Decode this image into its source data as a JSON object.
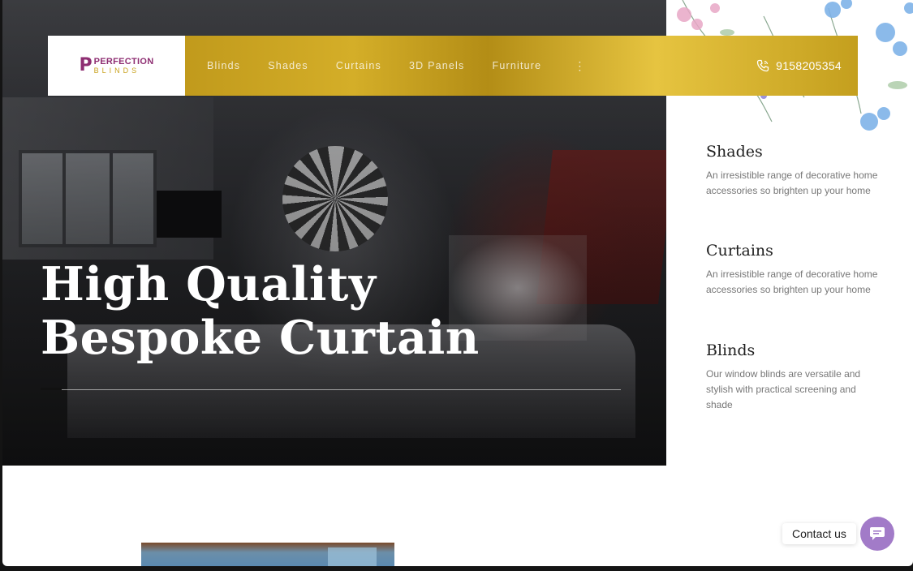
{
  "brand": {
    "logo_mark": "P",
    "logo_line1": "PERFECTION",
    "logo_line2": "BLINDS"
  },
  "nav": {
    "items": [
      {
        "label": "Blinds"
      },
      {
        "label": "Shades"
      },
      {
        "label": "Curtains"
      },
      {
        "label": "3D Panels"
      },
      {
        "label": "Furniture"
      }
    ],
    "more_label": "⋮",
    "phone_number": "9158205354"
  },
  "hero": {
    "heading_line1": "High Quality",
    "heading_line2": "Bespoke Curtain"
  },
  "features": [
    {
      "title": "Shades",
      "text": "An irresistible range of decorative home accessories so brighten up your home"
    },
    {
      "title": "Curtains",
      "text": "An irresistible range of decorative home accessories so brighten up your home"
    },
    {
      "title": "Blinds",
      "text": "Our window blinds are versatile and stylish with practical screening and shade"
    }
  ],
  "contact": {
    "label": "Contact us"
  },
  "colors": {
    "gold": "#d4ae28",
    "brand_purple": "#8e2e72",
    "contact_purple": "#a27bc8"
  },
  "icons": {
    "phone": "phone-icon",
    "chat": "chat-icon",
    "more": "more-vertical-icon"
  }
}
